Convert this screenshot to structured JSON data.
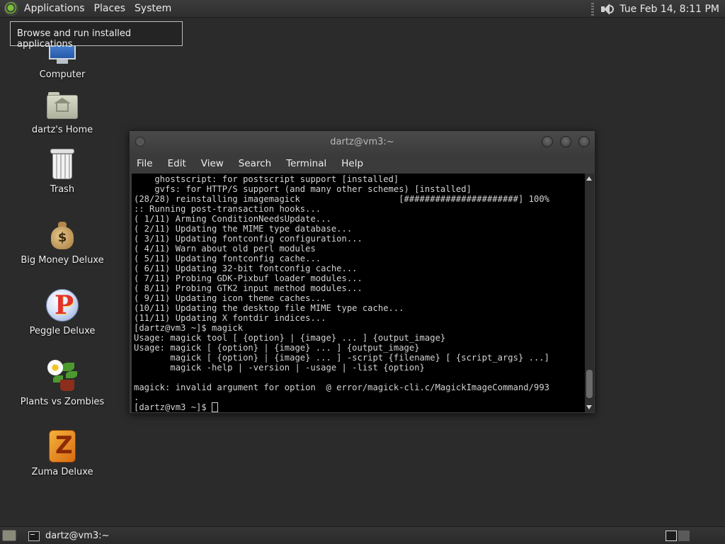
{
  "top_panel": {
    "menus": [
      "Applications",
      "Places",
      "System"
    ],
    "clock": "Tue Feb 14,  8:11 PM"
  },
  "tooltip": "Browse and run installed applications",
  "desktop_icons": [
    {
      "label": "Computer",
      "icon": "computer-icon"
    },
    {
      "label": "dartz's Home",
      "icon": "home-folder-icon"
    },
    {
      "label": "Trash",
      "icon": "trash-icon"
    },
    {
      "label": "Big Money Deluxe",
      "icon": "money-bag-icon"
    },
    {
      "label": "Peggle Deluxe",
      "icon": "peggle-icon"
    },
    {
      "label": "Plants vs Zombies",
      "icon": "plants-vs-zombies-icon"
    },
    {
      "label": "Zuma Deluxe",
      "icon": "zuma-icon"
    }
  ],
  "terminal": {
    "title": "dartz@vm3:~",
    "menus": [
      "File",
      "Edit",
      "View",
      "Search",
      "Terminal",
      "Help"
    ],
    "lines": [
      "    ghostscript: for postscript support [installed]",
      "    gvfs: for HTTP/S support (and many other schemes) [installed]",
      "(28/28) reinstalling imagemagick                   [######################] 100%",
      ":: Running post-transaction hooks...",
      "( 1/11) Arming ConditionNeedsUpdate...",
      "( 2/11) Updating the MIME type database...",
      "( 3/11) Updating fontconfig configuration...",
      "( 4/11) Warn about old perl modules",
      "( 5/11) Updating fontconfig cache...",
      "( 6/11) Updating 32-bit fontconfig cache...",
      "( 7/11) Probing GDK-Pixbuf loader modules...",
      "( 8/11) Probing GTK2 input method modules...",
      "( 9/11) Updating icon theme caches...",
      "(10/11) Updating the desktop file MIME type cache...",
      "(11/11) Updating X fontdir indices...",
      "[dartz@vm3 ~]$ magick",
      "Usage: magick tool [ {option} | {image} ... ] {output_image}",
      "Usage: magick [ {option} | {image} ... ] {output_image}",
      "       magick [ {option} | {image} ... ] -script {filename} [ {script_args} ...]",
      "       magick -help | -version | -usage | -list {option}",
      "",
      "magick: invalid argument for option  @ error/magick-cli.c/MagickImageCommand/993",
      "."
    ],
    "prompt": "[dartz@vm3 ~]$ "
  },
  "bottom_panel": {
    "task_label": "dartz@vm3:~"
  }
}
